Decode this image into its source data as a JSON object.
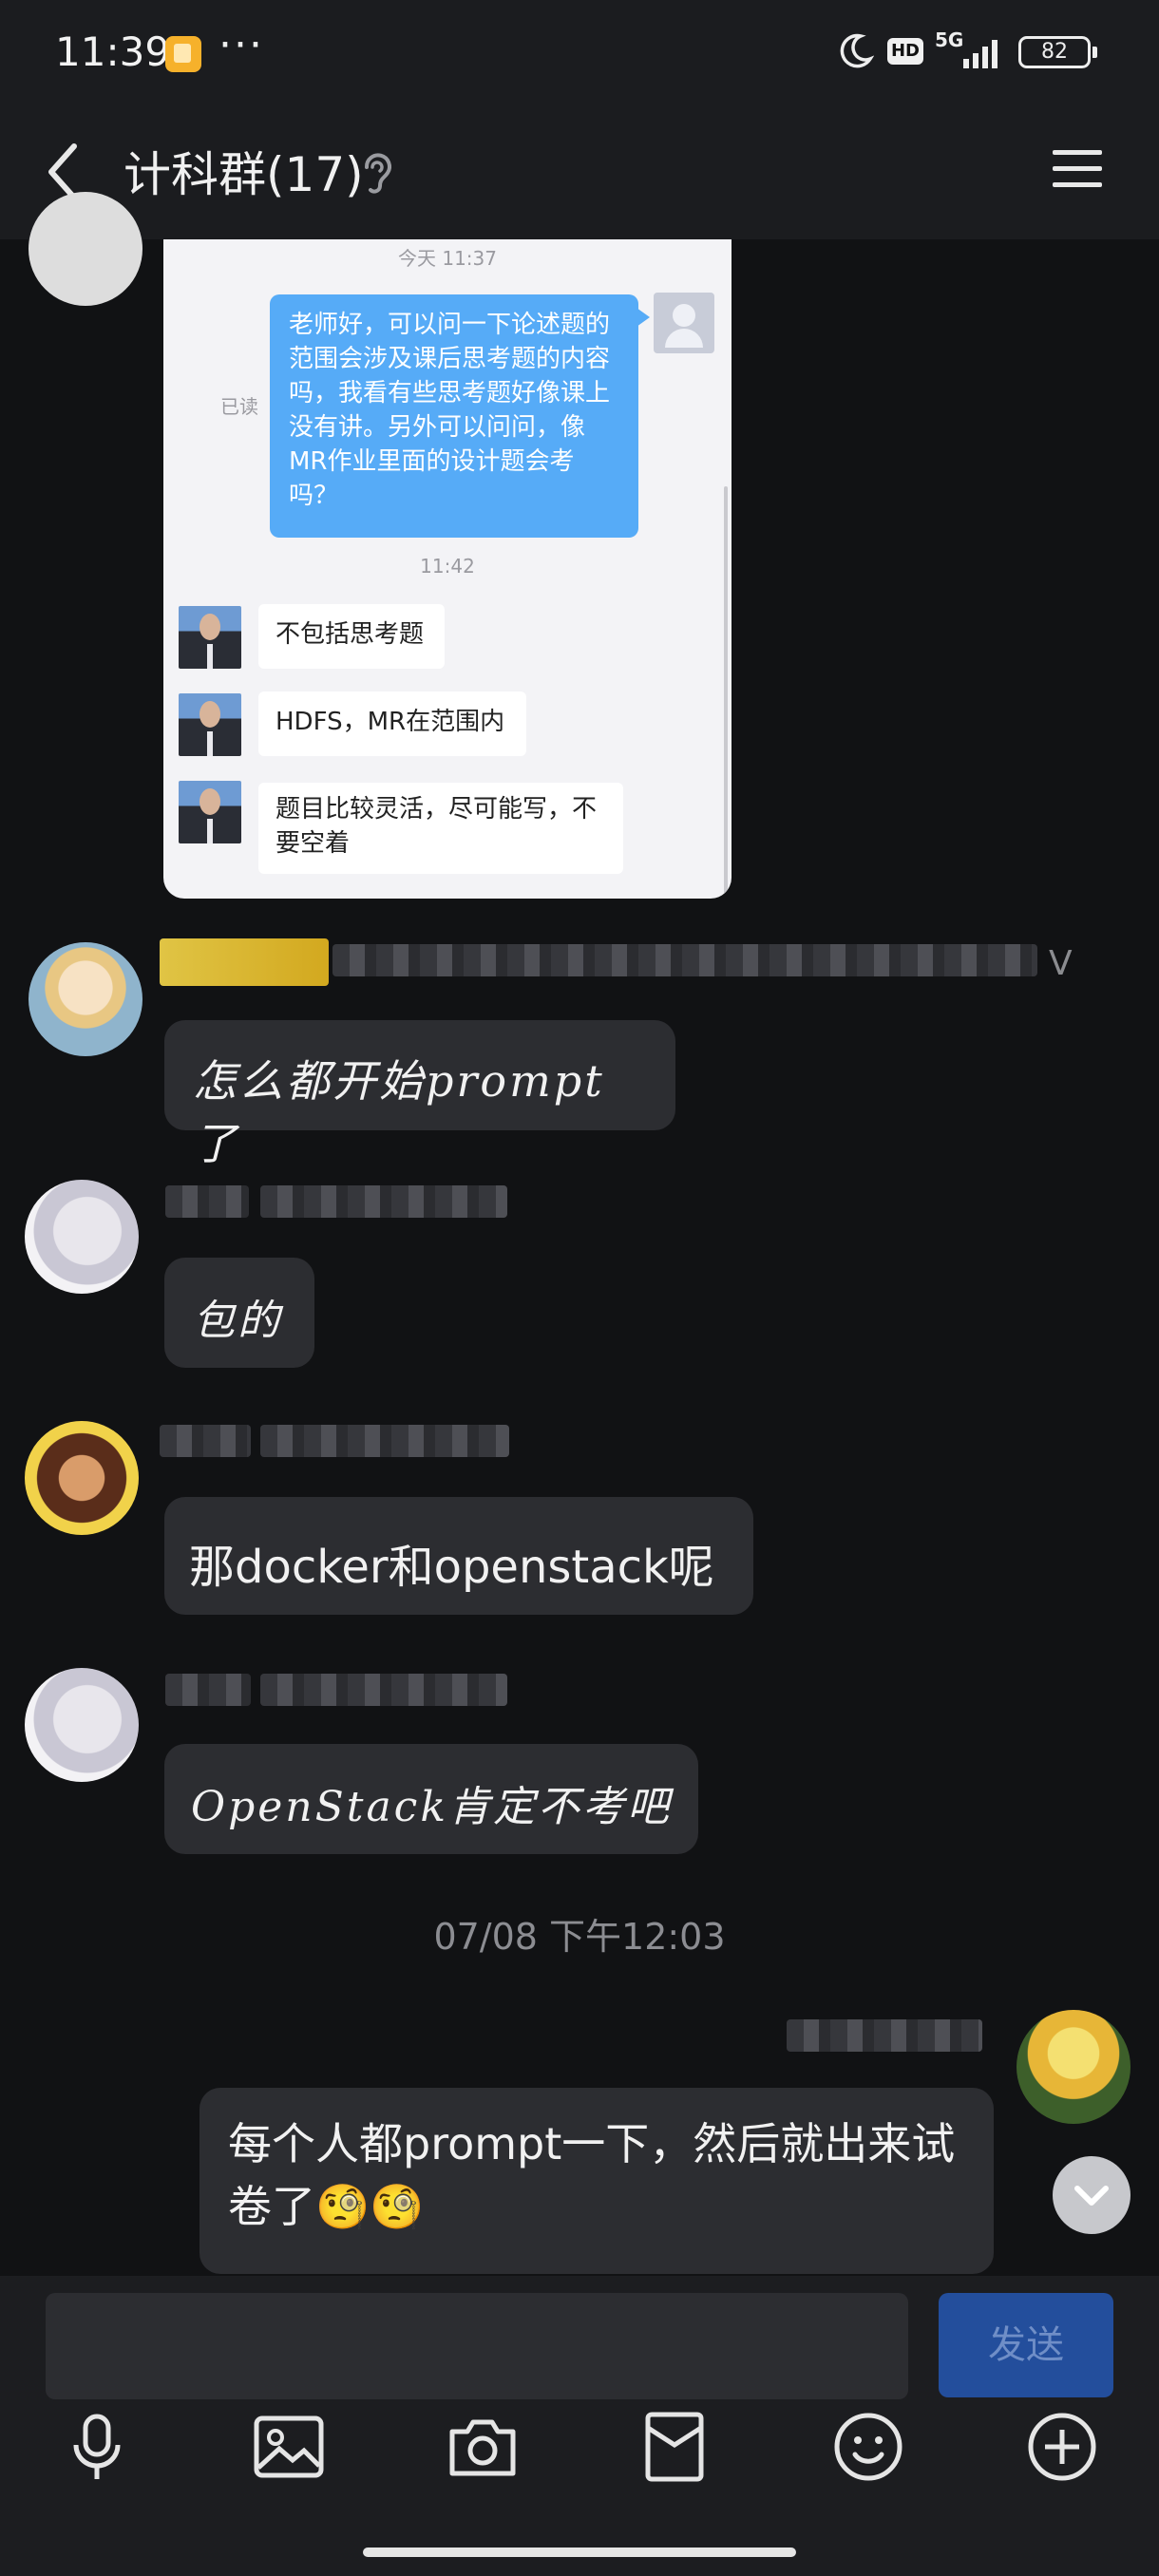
{
  "status_bar": {
    "time": "11:39",
    "network": "5G",
    "hd": "HD",
    "battery": "82",
    "more": "···"
  },
  "header": {
    "title": "计科群(17)"
  },
  "screenshot_card": {
    "time_1": "今天 11:37",
    "read_status": "已读",
    "question": "老师好，可以问一下论述题的范围会涉及课后思考题的内容吗，我看有些思考题好像课上没有讲。另外可以问问，像MR作业里面的设计题会考吗？",
    "time_2": "11:42",
    "replies": [
      "不包括思考题",
      "HDFS，MR在范围内",
      "题目比较灵活，尽可能写，不要空着"
    ]
  },
  "messages": [
    {
      "text": "怎么都开始prompt了"
    },
    {
      "text": "包的"
    },
    {
      "text": "那docker和openstack呢"
    },
    {
      "text": "OpenStack肯定不考吧"
    },
    {
      "text": "每个人都prompt一下，然后就出来试卷了🧐🧐"
    }
  ],
  "name_suffix": "V",
  "date_separator": "07/08 下午12:03",
  "input": {
    "placeholder": "",
    "send_label": "发送"
  },
  "toolbar": [
    "microphone-icon",
    "image-icon",
    "camera-icon",
    "red-packet-icon",
    "emoji-icon",
    "plus-icon"
  ]
}
